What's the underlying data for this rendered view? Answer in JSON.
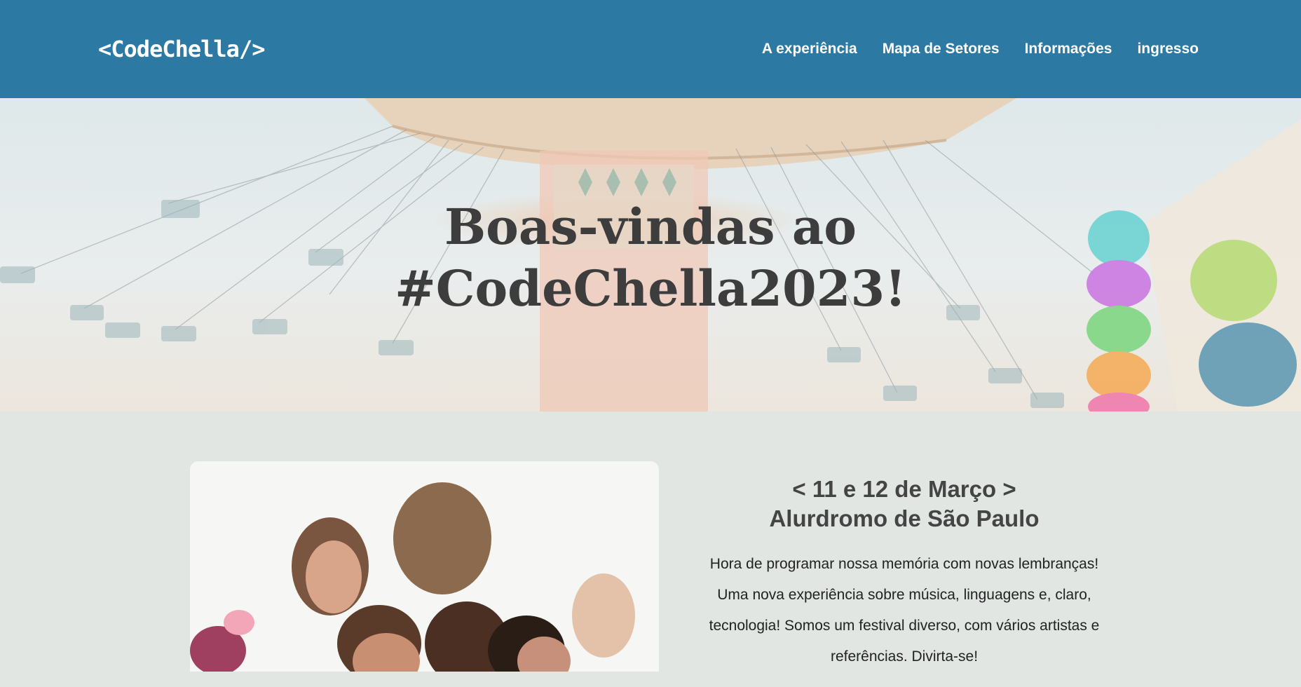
{
  "header": {
    "logo": "<CodeChella/>",
    "nav": [
      "A experiência",
      "Mapa de Setores",
      "Informações",
      "ingresso"
    ]
  },
  "hero": {
    "title_line1": "Boas-vindas ao",
    "title_line2": "#CodeChella2023!"
  },
  "event": {
    "date": "< 11 e 12 de Março >",
    "venue": "Alurdromo de São Paulo",
    "description": "Hora de programar nossa memória com novas lembranças! Uma nova experiência sobre música, linguagens e, claro, tecnologia! Somos um festival diverso, com vários artistas e referências. Divirta-se!"
  },
  "colors": {
    "header_bg": "#2c7aa3",
    "page_bg": "#e2e6e3",
    "title_text": "#3d3d3d"
  }
}
